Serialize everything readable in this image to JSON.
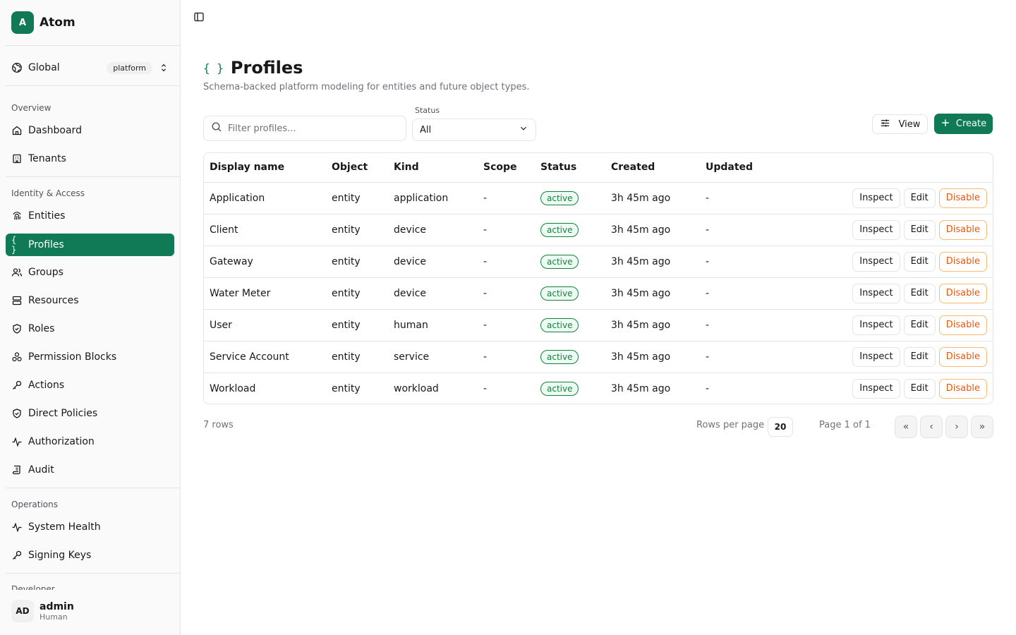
{
  "brand": {
    "logo_letter": "A",
    "name": "Atom"
  },
  "scope": {
    "label": "Global",
    "badge": "platform"
  },
  "sidebar": {
    "sections": [
      {
        "title": "Overview"
      },
      {
        "title": "Identity & Access"
      },
      {
        "title": "Operations"
      },
      {
        "title": "Developer"
      }
    ],
    "items": [
      {
        "label": "Dashboard",
        "icon": "home-icon"
      },
      {
        "label": "Tenants",
        "icon": "building-icon"
      },
      {
        "label": "Entities",
        "icon": "fingerprint-icon"
      },
      {
        "label": "Profiles",
        "icon": "braces-icon",
        "active": true
      },
      {
        "label": "Groups",
        "icon": "users-icon"
      },
      {
        "label": "Resources",
        "icon": "server-icon"
      },
      {
        "label": "Roles",
        "icon": "shield-check-icon"
      },
      {
        "label": "Permission Blocks",
        "icon": "blocks-icon"
      },
      {
        "label": "Actions",
        "icon": "key-icon"
      },
      {
        "label": "Direct Policies",
        "icon": "shield-check-icon"
      },
      {
        "label": "Authorization",
        "icon": "activity-icon"
      },
      {
        "label": "Audit",
        "icon": "scroll-icon"
      },
      {
        "label": "System Health",
        "icon": "activity-icon"
      },
      {
        "label": "Signing Keys",
        "icon": "key-icon"
      }
    ]
  },
  "user": {
    "initials": "AD",
    "name": "admin",
    "role": "Human"
  },
  "page": {
    "icon": "{ }",
    "title": "Profiles",
    "subtitle": "Schema-backed platform modeling for entities and future object types."
  },
  "toolbar": {
    "search_placeholder": "Filter profiles...",
    "status_label": "Status",
    "status_value": "All",
    "view_label": "View",
    "create_label": "Create"
  },
  "table": {
    "columns": [
      "Display name",
      "Object",
      "Kind",
      "Scope",
      "Status",
      "Created",
      "Updated"
    ],
    "rows": [
      {
        "name": "Application",
        "object": "entity",
        "kind": "application",
        "scope": "-",
        "status": "active",
        "created": "3h 45m ago",
        "updated": "-"
      },
      {
        "name": "Client",
        "object": "entity",
        "kind": "device",
        "scope": "-",
        "status": "active",
        "created": "3h 45m ago",
        "updated": "-"
      },
      {
        "name": "Gateway",
        "object": "entity",
        "kind": "device",
        "scope": "-",
        "status": "active",
        "created": "3h 45m ago",
        "updated": "-"
      },
      {
        "name": "Water Meter",
        "object": "entity",
        "kind": "device",
        "scope": "-",
        "status": "active",
        "created": "3h 45m ago",
        "updated": "-"
      },
      {
        "name": "User",
        "object": "entity",
        "kind": "human",
        "scope": "-",
        "status": "active",
        "created": "3h 45m ago",
        "updated": "-"
      },
      {
        "name": "Service Account",
        "object": "entity",
        "kind": "service",
        "scope": "-",
        "status": "active",
        "created": "3h 45m ago",
        "updated": "-"
      },
      {
        "name": "Workload",
        "object": "entity",
        "kind": "workload",
        "scope": "-",
        "status": "active",
        "created": "3h 45m ago",
        "updated": "-"
      }
    ],
    "row_actions": {
      "inspect": "Inspect",
      "edit": "Edit",
      "disable": "Disable"
    }
  },
  "pagination": {
    "rows_count": "7 rows",
    "rows_per_page_label": "Rows per page",
    "rows_per_page": "20",
    "page_label": "Page 1 of 1",
    "first": "«",
    "prev": "‹",
    "next": "›",
    "last": "»"
  },
  "colors": {
    "accent": "#0f7a55",
    "active_badge": "#15803d",
    "disable": "#ea580c"
  }
}
